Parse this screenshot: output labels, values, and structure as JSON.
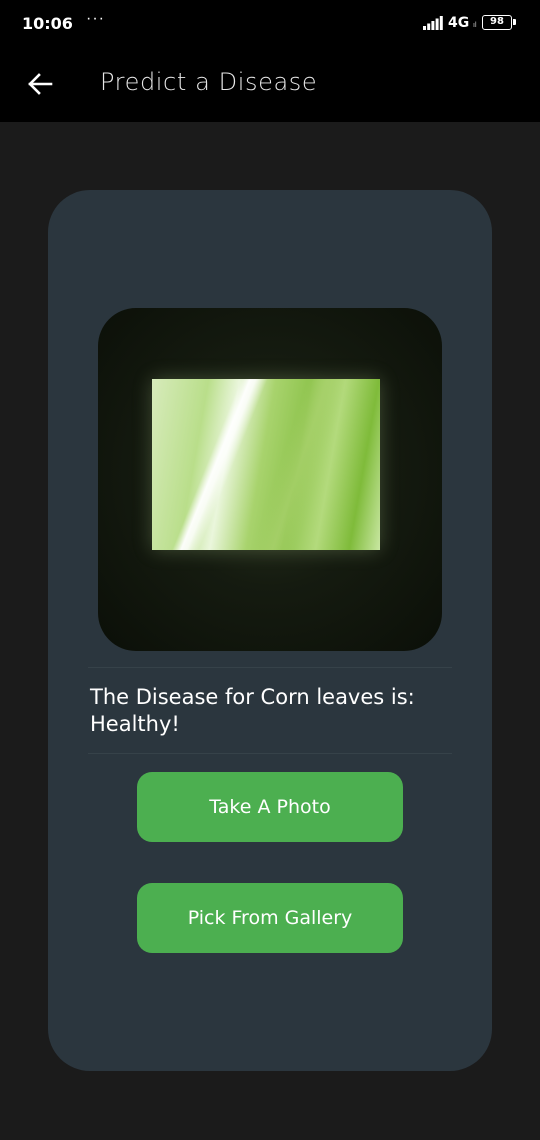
{
  "status_bar": {
    "time": "10:06",
    "dots": "···",
    "network": "4G",
    "network_sub": "ıl",
    "battery": "98"
  },
  "app_bar": {
    "back_icon": "arrow-left-icon",
    "title": "Predict a Disease"
  },
  "card": {
    "result_line1": "The Disease for Corn leaves is:",
    "result_line2": "Healthy!",
    "take_photo_label": "Take A Photo",
    "pick_gallery_label": "Pick From Gallery"
  },
  "colors": {
    "app_bar_bg": "#000000",
    "page_bg": "#1b1b1b",
    "card_bg": "#2b363e",
    "button_bg": "#4caf50",
    "text": "#ffffff"
  }
}
